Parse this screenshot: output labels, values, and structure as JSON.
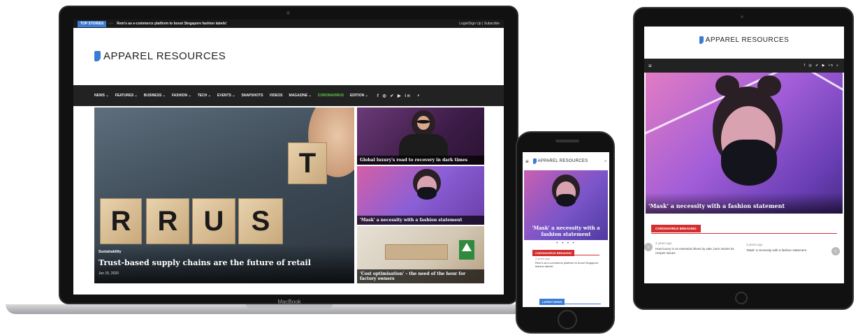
{
  "laptop": {
    "brand": "MacBook",
    "topbar": {
      "top_stories_label": "TOP STORIES",
      "arrows": "‹ ›",
      "ticker_headline": "Rem's as e-commerce platform to boost Singapore fashion labels!",
      "login": "Login/Sign Up | Subscribe"
    },
    "logo_text": "APPAREL RESOURCES",
    "nav": {
      "items": [
        "NEWS ⌄",
        "FEATURES ⌄",
        "BUSINESS ⌄",
        "FASHION ⌄",
        "TECH ⌄",
        "EVENTS ⌄",
        "SNAPSHOTS",
        "VIDEOS",
        "MAGAZINE ⌄"
      ],
      "accent_item": "CORONAVIRUS",
      "edition": "EDITION ⌄",
      "social_icons": "f ◎ ✔ ▶ in",
      "search_icon": "⌕"
    },
    "hero": {
      "tag": "Sustainability",
      "title": "Trust-based supply chains are the future of retail",
      "date": "Jun 15, 2020",
      "cube_letters": [
        "T",
        "R",
        "U",
        "S",
        "T"
      ]
    },
    "cards": [
      {
        "title": "Global luxury's road to recovery in dark times"
      },
      {
        "title": "'Mask' a necessity with a fashion statement"
      },
      {
        "title": "'Cost optimisation' – the need of the hour for factory owners"
      }
    ]
  },
  "phone": {
    "logo_text": "APPAREL RESOURCES",
    "menu_icon": "≡",
    "search_icon": "⌕",
    "hero_title": "'Mask' a necessity with a fashion statement",
    "dots": "• • • •",
    "section_label": "CORONAVIRUS BREAKING",
    "story_time": "3 years ago",
    "story_text": "Rem's as e-commerce platform to boost Singapore fashion labels!",
    "latest_label": "LATEST NEWS"
  },
  "tablet": {
    "logo_text": "APPAREL RESOURCES",
    "menu_icon": "≡",
    "social_icons": "f ◎ ✔ ▶ in ⌕",
    "hero_title": "'Mask' a necessity with a fashion statement",
    "section_label": "CORONAVIRUS BREAKING",
    "stories": [
      {
        "time": "3 years ago",
        "text": "How luxury is on essential drives by sale, born stories its recipes issues"
      },
      {
        "time": "3 years ago",
        "text": "'Mask' a necessity with a fashion statement"
      }
    ],
    "prev_icon": "‹",
    "next_icon": "›"
  },
  "colors": {
    "accent_blue": "#3a7bd5",
    "accent_green": "#5ecb4a",
    "section_red": "#d32f2f",
    "nav_dark": "#222222"
  }
}
